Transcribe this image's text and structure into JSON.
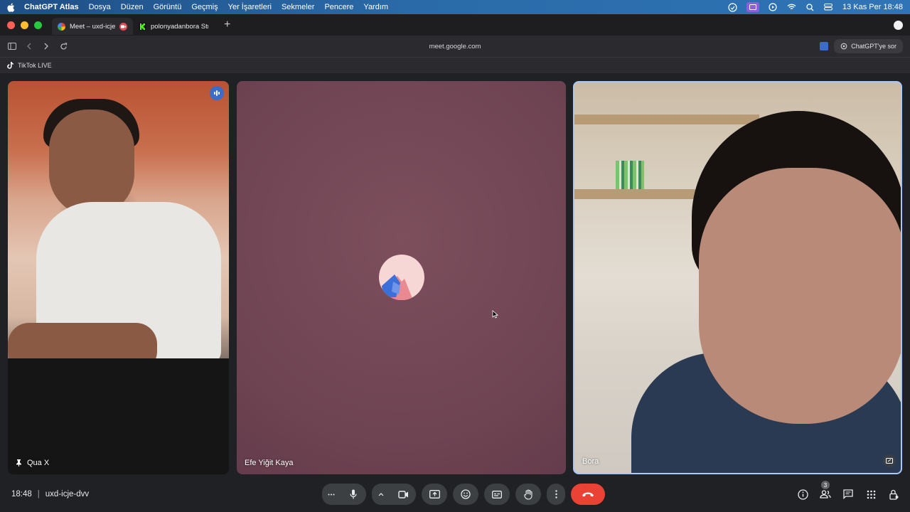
{
  "menubar": {
    "app": "ChatGPT Atlas",
    "items": [
      "Dosya",
      "Düzen",
      "Görüntü",
      "Geçmiş",
      "Yer İşaretleri",
      "Sekmeler",
      "Pencere",
      "Yardım"
    ],
    "datetime": "13 Kas Per  18:48"
  },
  "tabs": [
    {
      "title": "Meet – uxd-icje-dvv",
      "active": true
    },
    {
      "title": "polonyadanbora Stre",
      "active": false
    }
  ],
  "address": {
    "url": "meet.google.com",
    "ask_label": "ChatGPT'ye sor"
  },
  "bookmarks": [
    {
      "label": "TikTok LIVE"
    }
  ],
  "participants": [
    {
      "name": "Qua X"
    },
    {
      "name": "Efe Yiğit Kaya"
    },
    {
      "name": "Bora"
    }
  ],
  "meeting": {
    "time": "18:48",
    "code": "uxd-icje-dvv",
    "people_count": "3"
  },
  "colors": {
    "end_call": "#ea4335",
    "active_border": "#a8c7fa",
    "accent": "#3c6cc9"
  }
}
